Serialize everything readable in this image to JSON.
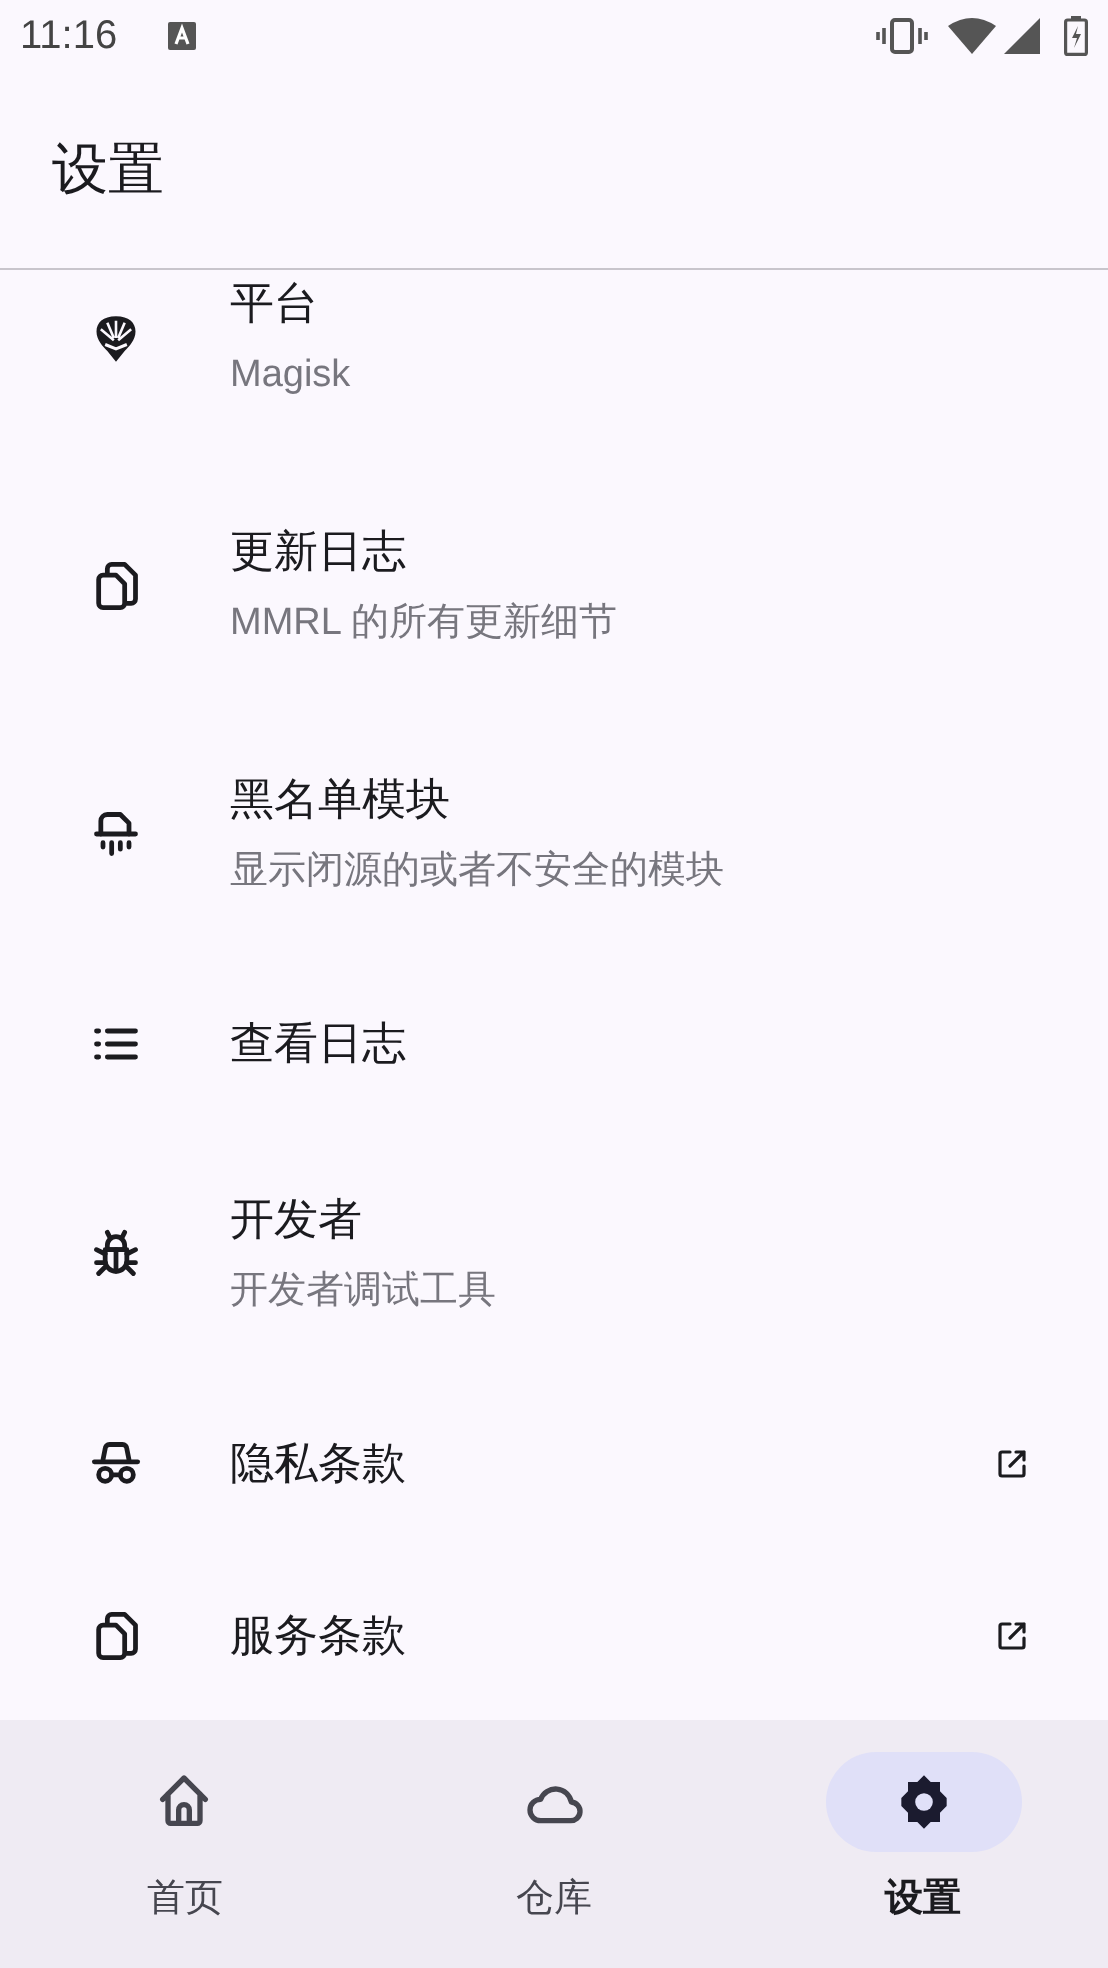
{
  "status_bar": {
    "time": "11:16"
  },
  "app_bar": {
    "title": "设置"
  },
  "settings": [
    {
      "title": "平台",
      "subtitle": "Magisk",
      "external": false
    },
    {
      "title": "更新日志",
      "subtitle": "MMRL 的所有更新细节",
      "external": false
    },
    {
      "title": "黑名单模块",
      "subtitle": "显示闭源的或者不安全的模块",
      "external": false
    },
    {
      "title": "查看日志",
      "external": false
    },
    {
      "title": "开发者",
      "subtitle": "开发者调试工具",
      "external": false
    },
    {
      "title": "隐私条款",
      "external": true
    },
    {
      "title": "服务条款",
      "external": true
    }
  ],
  "bottom_nav": [
    {
      "label": "首页",
      "selected": false
    },
    {
      "label": "仓库",
      "selected": false
    },
    {
      "label": "设置",
      "selected": true
    }
  ]
}
